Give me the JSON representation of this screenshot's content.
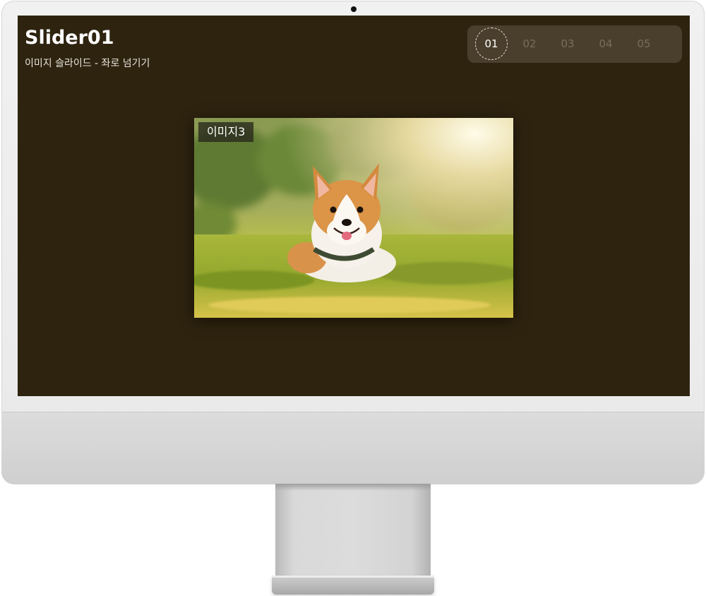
{
  "header": {
    "title": "Slider01",
    "subtitle": "이미지 슬라이드 - 좌로 넘기기"
  },
  "pagination": {
    "items": [
      "01",
      "02",
      "03",
      "04",
      "05"
    ],
    "active_index": 0
  },
  "slide": {
    "label": "이미지3",
    "image": "corgi-dog-in-grass-photo"
  },
  "colors": {
    "screen_background": "#2e230f",
    "pager_background": "#4a3f2d",
    "inactive_page_text": "#7a6d58",
    "active_page_text": "#ffffff"
  }
}
